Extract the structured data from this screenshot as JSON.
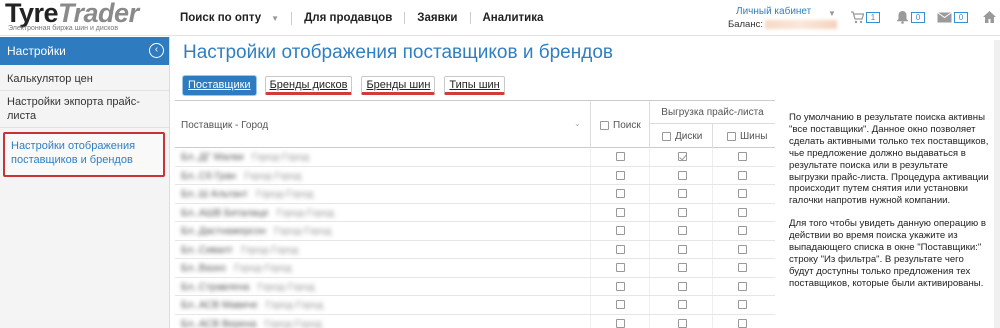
{
  "logo": {
    "brand_part1": "Tyre",
    "brand_part2": "Trader",
    "tagline": "Электронная биржа шин и дисков"
  },
  "nav": {
    "items": [
      "Поиск по опту",
      "Для продавцов",
      "Заявки",
      "Аналитика"
    ],
    "caret": "▼"
  },
  "account": {
    "link": "Личный кабинет",
    "balance_label": "Баланс:",
    "caret": "▼"
  },
  "header_icons": {
    "cart_count": "1",
    "bell_count": "0",
    "mail_count": "0"
  },
  "sidebar": {
    "title": "Настройки",
    "toggle_glyph": "‹",
    "items": [
      {
        "label": "Калькулятор цен"
      },
      {
        "label": "Настройки экпорта прайс-листа"
      },
      {
        "label": "Настройки отображения поставщиков и брендов"
      }
    ]
  },
  "main": {
    "title": "Настройки отображения поставщиков и брендов",
    "tabs": [
      "Поставщики",
      "Бренды дисков",
      "Бренды шин",
      "Типы шин"
    ]
  },
  "table": {
    "headers": {
      "supplier": "Поставщик - Город",
      "sort_glyph": "⌄",
      "search": "Поиск",
      "export": "Выгрузка прайс-листа",
      "discs": "Диски",
      "tires": "Шины"
    },
    "rows": [
      {
        "name": "Бл..ДГ Малки",
        "city": "Город-Город",
        "search": false,
        "discs": true,
        "tires": false
      },
      {
        "name": "Бл..Сб Гран",
        "city": "Город-Город",
        "search": false,
        "discs": false,
        "tires": false
      },
      {
        "name": "Бл..Ш Альтант",
        "city": "Город-Город",
        "search": false,
        "discs": false,
        "tires": false
      },
      {
        "name": "Бл..АШВ Беталаце",
        "city": "Город-Город",
        "search": false,
        "discs": false,
        "tires": false
      },
      {
        "name": "Бл..Дастнажерсон",
        "city": "Город-Город",
        "search": false,
        "discs": false,
        "tires": false
      },
      {
        "name": "Бл..Сивалт",
        "city": "Город-Город",
        "search": false,
        "discs": false,
        "tires": false
      },
      {
        "name": "Бл..Вазхо",
        "city": "Город-Город",
        "search": false,
        "discs": false,
        "tires": false
      },
      {
        "name": "Бл..Стравлена",
        "city": "Город-Город",
        "search": false,
        "discs": false,
        "tires": false
      },
      {
        "name": "Бл..АСВ Мавиче",
        "city": "Город-Город",
        "search": false,
        "discs": false,
        "tires": false
      },
      {
        "name": "Бл..АСВ Верена",
        "city": "Город-Город",
        "search": false,
        "discs": false,
        "tires": false
      }
    ]
  },
  "info": {
    "paragraph1": "По умолчанию в результате поиска активны \"все поставщики\". Данное окно позволяет сделать активными только тех поставщиков, чье предложение должно выдаваться в результате поиска или в результате выгрузки прайс-листа. Процедура активации происходит путем снятия или установки галочки напротив нужной компании.",
    "paragraph2": "Для того чтобы увидеть данную операцию в действии во время поиска укажите из выпадающего списка в окне \"Поставщики:\" строку \"Из фильтра\". В результате чего будут доступны только предложения тех поставщиков, которые были активированы."
  },
  "colors": {
    "accent": "#2e7bbf",
    "link": "#2f7fc1",
    "highlight_border": "#c83434"
  }
}
